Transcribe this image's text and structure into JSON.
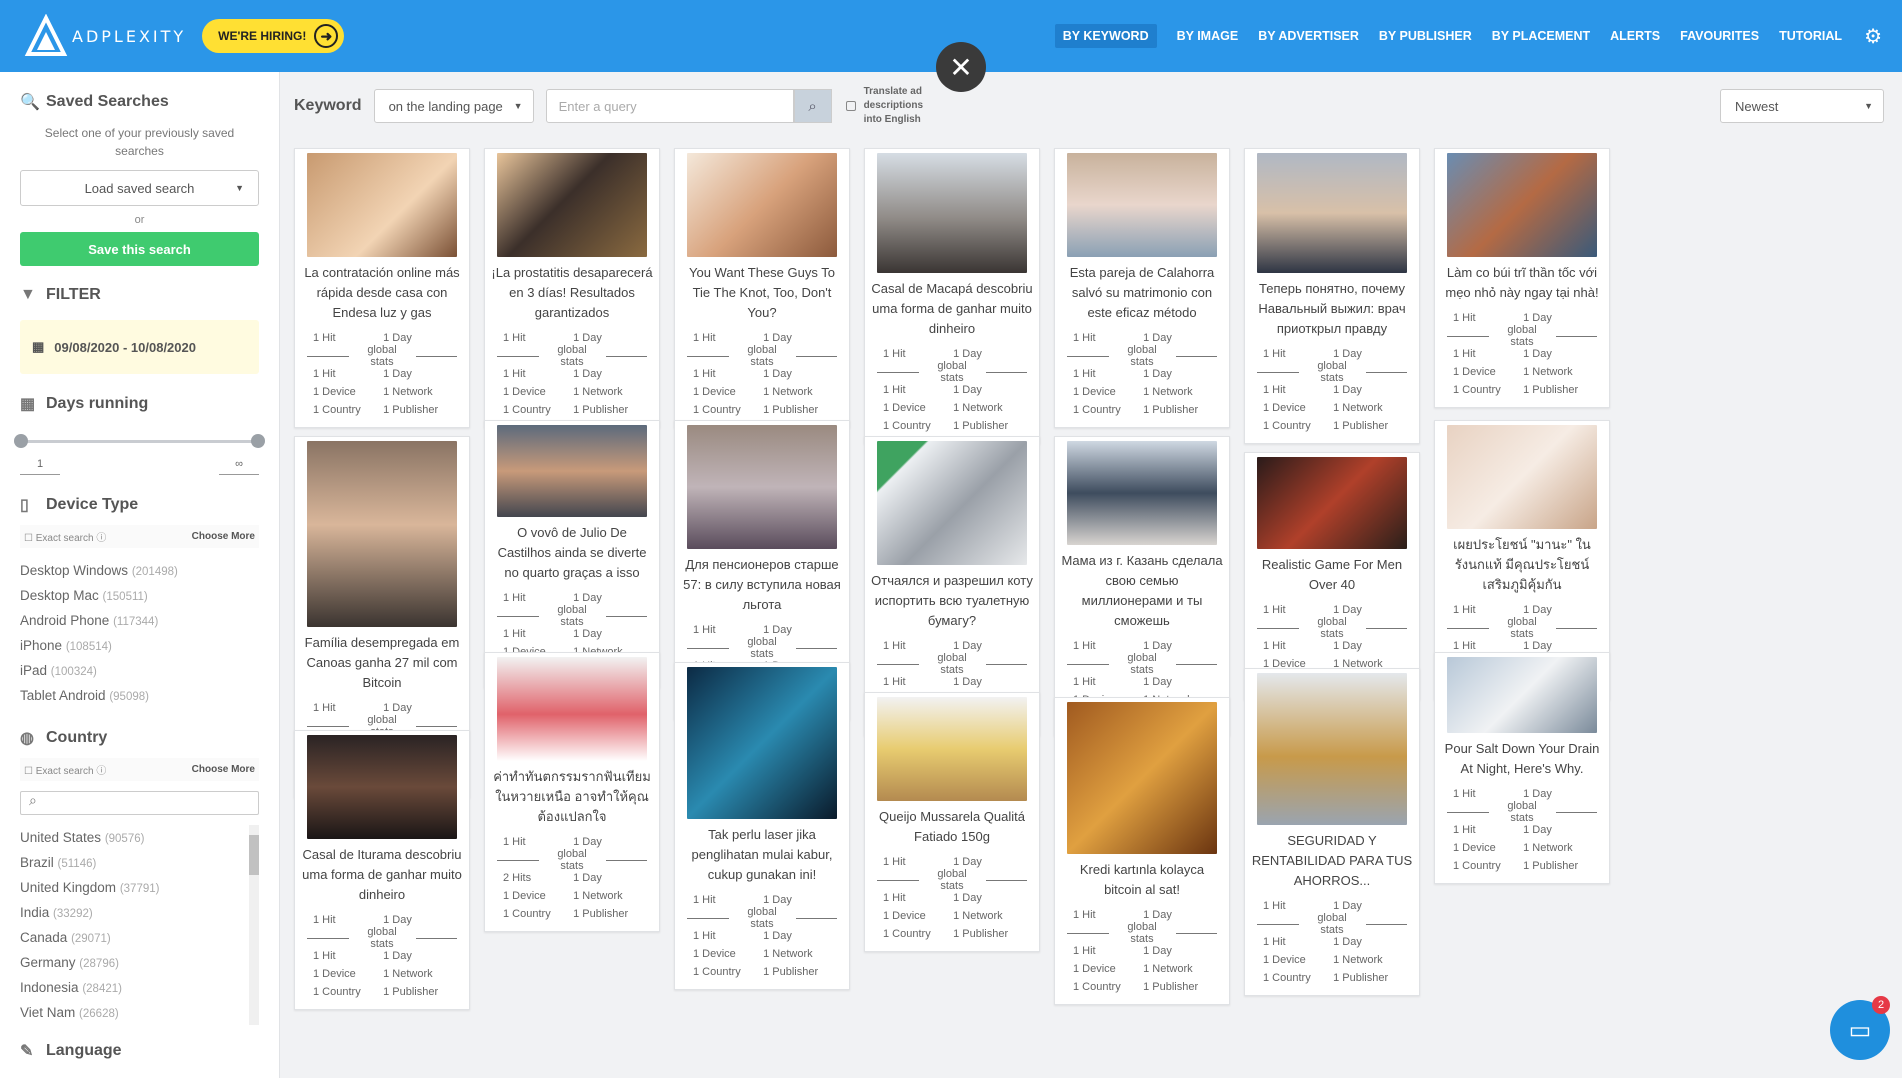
{
  "brand": {
    "name": "ADPLEXITY",
    "hiring": "WE'RE HIRING!"
  },
  "nav": [
    "BY KEYWORD",
    "BY IMAGE",
    "BY ADVERTISER",
    "BY PUBLISHER",
    "BY PLACEMENT",
    "ALERTS",
    "FAVOURITES",
    "TUTORIAL"
  ],
  "sidebar": {
    "saved_title": "Saved Searches",
    "saved_sub": "Select one of your previously saved searches",
    "load_label": "Load saved search",
    "or": "or",
    "save_label": "Save this search",
    "filter_title": "FILTER",
    "date_range": "09/08/2020 - 10/08/2020",
    "days_title": "Days running",
    "days_min": "1",
    "days_max": "∞",
    "device_title": "Device Type",
    "exact": "Exact search",
    "choose": "Choose More",
    "devices": [
      {
        "name": "Desktop Windows",
        "count": "(201498)"
      },
      {
        "name": "Desktop Mac",
        "count": "(150511)"
      },
      {
        "name": "Android Phone",
        "count": "(117344)"
      },
      {
        "name": "iPhone",
        "count": "(108514)"
      },
      {
        "name": "iPad",
        "count": "(100324)"
      },
      {
        "name": "Tablet Android",
        "count": "(95098)"
      }
    ],
    "country_title": "Country",
    "countries": [
      {
        "name": "United States",
        "count": "(90576)"
      },
      {
        "name": "Brazil",
        "count": "(51146)"
      },
      {
        "name": "United Kingdom",
        "count": "(37791)"
      },
      {
        "name": "India",
        "count": "(33292)"
      },
      {
        "name": "Canada",
        "count": "(29071)"
      },
      {
        "name": "Germany",
        "count": "(28796)"
      },
      {
        "name": "Indonesia",
        "count": "(28421)"
      },
      {
        "name": "Viet Nam",
        "count": "(26628)"
      }
    ],
    "language_title": "Language"
  },
  "query": {
    "label": "Keyword",
    "scope": "on the landing page",
    "placeholder": "Enter a query",
    "translate": "Translate ad descriptions into English",
    "sort": "Newest"
  },
  "stats_labels": {
    "hit": "1 Hit",
    "hits2": "2 Hits",
    "day": "1 Day",
    "global": "global stats",
    "device": "1 Device",
    "network": "1 Network",
    "country": "1 Country",
    "publisher": "1 Publisher"
  },
  "cards": [
    {
      "title": "La contratación online más rápida desde casa con Endesa luz y gas"
    },
    {
      "title": "¡La prostatitis desaparecerá en 3 días! Resultados garantizados"
    },
    {
      "title": "You Want These Guys To Tie The Knot, Too, Don't You?"
    },
    {
      "title": "Casal de Macapá descobriu uma forma de ganhar muito dinheiro"
    },
    {
      "title": "Esta pareja de Calahorra salvó su matrimonio con este eficaz método"
    },
    {
      "title": "Теперь понятно, почему Навальный выжил: врач приоткрыл правду"
    },
    {
      "title": "Làm co búi trĩ thần tốc với mẹo nhỏ này ngay tại nhà!"
    },
    {
      "title": "Família desempregada em Canoas ganha 27 mil com Bitcoin"
    },
    {
      "title": "O vovô de Julio De Castilhos ainda se diverte no quarto graças a isso"
    },
    {
      "title": "Для пенсионеров старше 57: в силу вступила новая льгота"
    },
    {
      "title": "Отчаялся и разрешил коту испортить всю туалетную бумагу?"
    },
    {
      "title": "Мама из г. Казань сделала свою семью миллионерами и ты сможешь"
    },
    {
      "title": "Realistic Game For Men Over 40"
    },
    {
      "title": "เผยประโยชน์ \"มานะ\" ในรังนกแท้ มีคุณประโยชน์เสริมภูมิคุ้มกัน"
    },
    {
      "title": "Casal de Iturama descobriu uma forma de ganhar muito dinheiro"
    },
    {
      "title": "ค่าทำทันตกรรมรากฟันเทียมในหวายเหนือ อาจทำให้คุณต้องแปลกใจ"
    },
    {
      "title": "Tak perlu laser jika penglihatan mulai kabur, cukup gunakan ini!"
    },
    {
      "title": "Queijo Mussarela Qualitá Fatiado 150g"
    },
    {
      "title": "Kredi kartınla kolayca bitcoin al sat!"
    },
    {
      "title": "SEGURIDAD Y RENTABILIDAD PARA TUS AHORROS..."
    },
    {
      "title": "Pour Salt Down Your Drain At Night, Here's Why."
    }
  ],
  "chat_badge": "2"
}
